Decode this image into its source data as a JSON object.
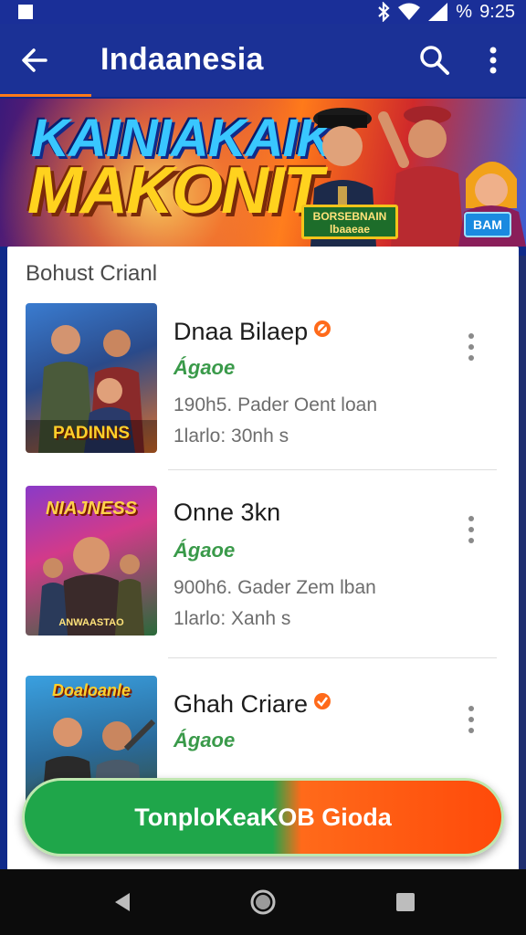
{
  "status_bar": {
    "battery_percent": "%",
    "time": "9:25",
    "icons": [
      "notification-square-icon",
      "bluetooth-icon",
      "wifi-icon",
      "signal-icon"
    ]
  },
  "app_bar": {
    "title": "Indaanesia",
    "back_icon": "back-arrow-icon",
    "search_icon": "search-icon",
    "more_icon": "more-vert-icon",
    "accent": "#ff7a1a"
  },
  "banner": {
    "headline_line1": "KAINIAKAIK",
    "headline_line2": "MAKONIT",
    "sign_text": "BORSEBNAIN\nlbaaeae",
    "badge": "BAM"
  },
  "list": {
    "section_title": "Bohust Crianl",
    "items": [
      {
        "name": "Dnaa Bilaep",
        "rating_text": "Ágaoe",
        "line3": "190h5. Pader Oent loan",
        "line4": "1larlo: 30nh  s",
        "thumb_label": "PADINNS",
        "verified": true
      },
      {
        "name": "Onne 3kn",
        "rating_text": "Ágaoe",
        "line3": "900h6. Gader Zem lban",
        "line4": "1larlo: Xanh  s",
        "thumb_label": "NIAJNESS",
        "thumb_sub": "ANWAASTAO",
        "verified": false
      },
      {
        "name": "Ghah Criare",
        "rating_text": "Ágaoe",
        "line3": "",
        "line4": "",
        "thumb_label": "Doaloanle",
        "verified": true
      }
    ]
  },
  "cta": {
    "label": "TonploKeaKOB Gioda",
    "color_left": "#1fa64a",
    "color_right": "#ff4a0a"
  },
  "nav_bar": {
    "icons": [
      "back-triangle-icon",
      "home-circle-icon",
      "recents-square-icon"
    ]
  }
}
